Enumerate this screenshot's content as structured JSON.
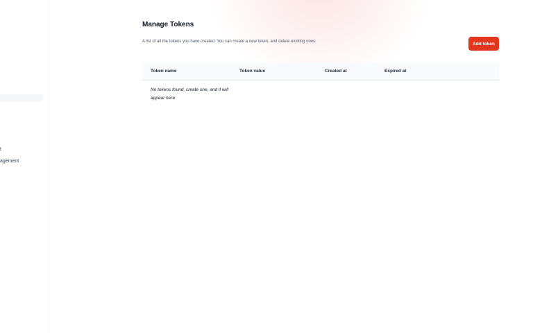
{
  "sidebar": {
    "items": [
      {
        "label": "t"
      },
      {
        "label": "agement"
      }
    ]
  },
  "page": {
    "title": "Manage Tokens",
    "description": "A list of all the tokens you have created. You can create a new token, and delete existing ones.",
    "add_button_label": "Add token"
  },
  "table": {
    "columns": [
      "Token name",
      "Token value",
      "Created at",
      "Expired at"
    ],
    "rows": [],
    "empty_message": "No tokens found, create one, and it will appear here"
  },
  "colors": {
    "accent": "#e2371d",
    "table_header_bg": "#f9fafb"
  }
}
